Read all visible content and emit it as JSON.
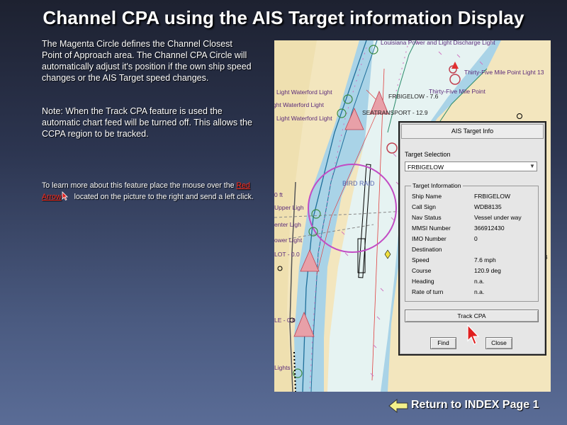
{
  "page": {
    "title": "Channel CPA using the AIS Target information Display",
    "description1": "The Magenta Circle defines the Channel Closest Point of Approach area.  The Channel CPA Circle will automatically adjust it's position if the own ship speed changes or the AIS Target speed changes.",
    "description2": "Note:  When the Track CPA feature is used the automatic chart feed will be turned off. This allows the CCPA region to be tracked.",
    "learn_more_prefix": "To learn more about this feature place the  mouse over the ",
    "learn_more_link": "Red Arrow",
    "learn_more_suffix": " located on the picture to the right and send a left click.",
    "return_link": "Return to INDEX Page 1"
  },
  "chart_labels": {
    "louisiana": "Louisiana Power and Light Discharge Light",
    "thirty_five_mile": "Thirty-Five Mile Point Light 13",
    "thirty_five_short": "Thirty-Five Mile Point",
    "light_waterford_1": "Light Waterford Light",
    "light_waterford_2": "ght Waterford Light",
    "light_waterford_3": "Light Waterford Light",
    "frbigelow_label": "FRBIGELOW - 7.6",
    "seatransport_label": "SEATRANSPORT - 12.9",
    "upper_light": "Upper Ligh",
    "center_light": "enter Ligh",
    "ower_light": "ower Light",
    "ft": "0 ft",
    "lot": "LOT - 0.0",
    "le": "LE - 0.0",
    "lights": "Lights",
    "own_ship": "BIRD RAID",
    "b_marker": "B"
  },
  "ais_dialog": {
    "title": "AIS Target Info",
    "target_selection_label": "Target Selection",
    "selected_target": "FRBIGELOW",
    "target_info_legend": "Target Information",
    "rows": [
      {
        "label": "Ship Name",
        "value": "FRBIGELOW"
      },
      {
        "label": "Call Sign",
        "value": "WDB8135"
      },
      {
        "label": "Nav Status",
        "value": "Vessel under way"
      },
      {
        "label": "MMSI Number",
        "value": "366912430"
      },
      {
        "label": "IMO Number",
        "value": "0"
      },
      {
        "label": "Destination",
        "value": ""
      },
      {
        "label": "Speed",
        "value": "7.6 mph"
      },
      {
        "label": "Course",
        "value": "120.9 deg"
      },
      {
        "label": "Heading",
        "value": "n.a."
      },
      {
        "label": "Rate of turn",
        "value": "n.a."
      }
    ],
    "track_cpa_button": "Track CPA",
    "find_button": "Find",
    "close_button": "Close"
  },
  "colors": {
    "cpa_circle": "#c24bc4",
    "red_arrow": "#e02020",
    "link_red": "#ff2a1a",
    "return_arrow": "#f4f08a"
  },
  "icons": {
    "red_arrow": "cursor-arrow-icon",
    "return": "left-arrow-icon"
  }
}
